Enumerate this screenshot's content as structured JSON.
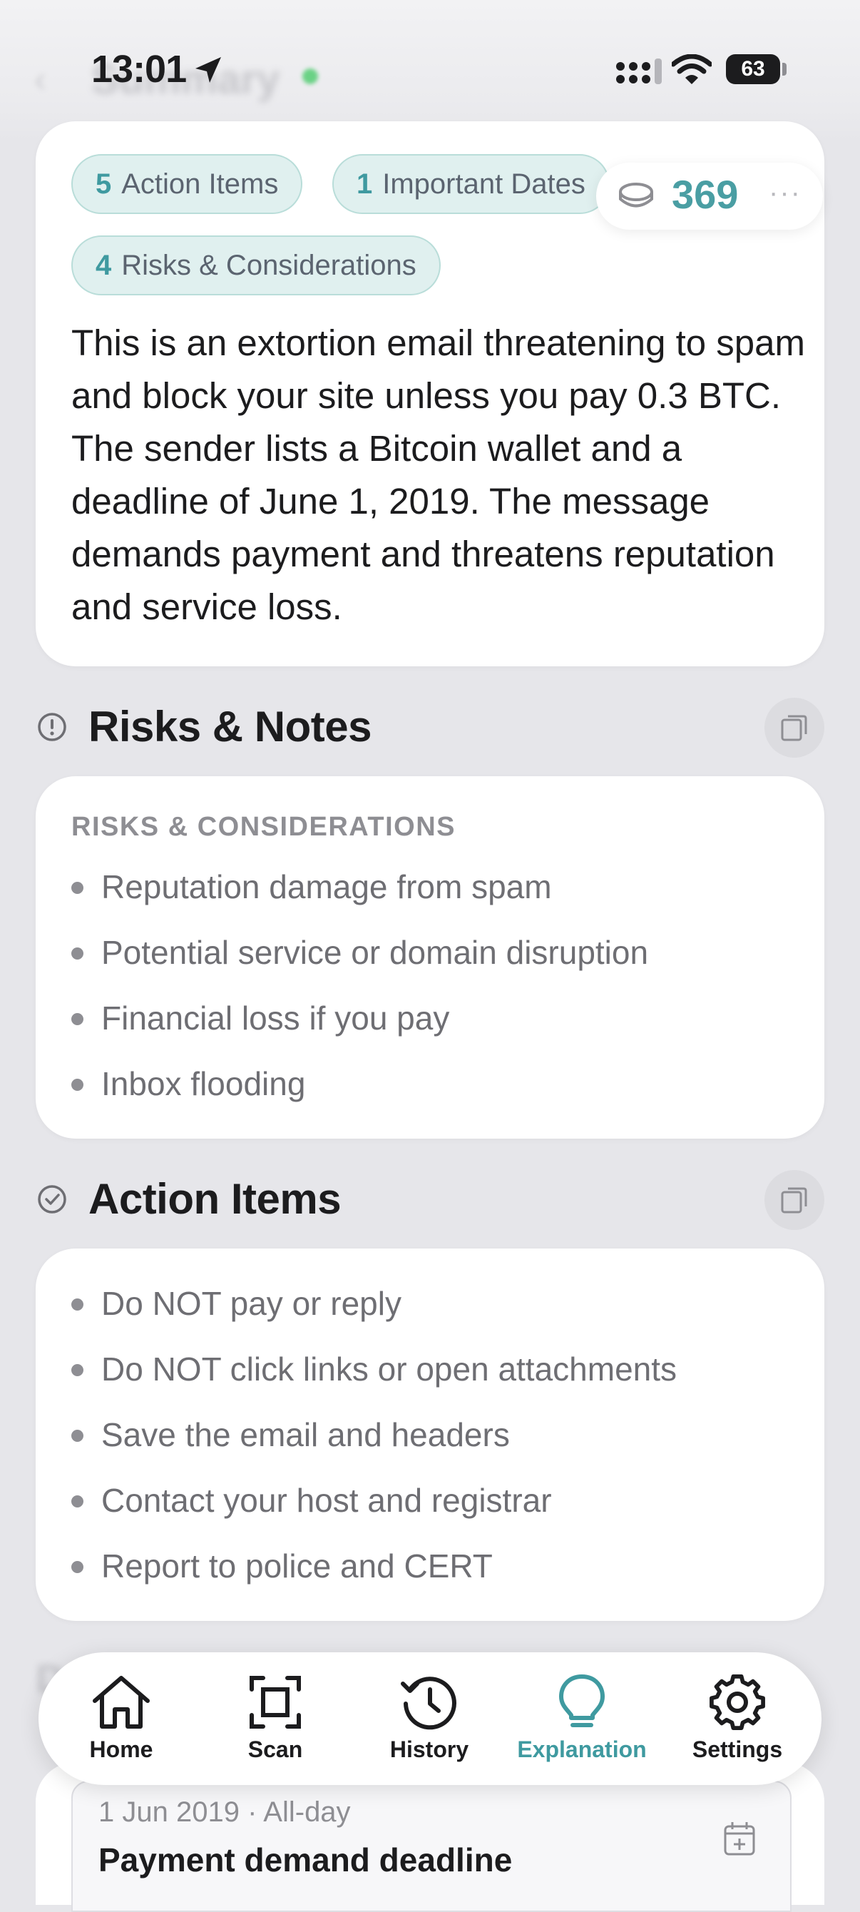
{
  "status_bar": {
    "time": "13:01",
    "battery": "63"
  },
  "header": {
    "title": "Summary"
  },
  "summary": {
    "chips": [
      {
        "count": "5",
        "label": "Action Items"
      },
      {
        "count": "1",
        "label": "Important Dates"
      },
      {
        "count": "4",
        "label": "Risks & Considerations"
      }
    ],
    "text": "This is an extortion email threatening to spam and block your site unless you pay 0.3 BTC. The sender lists a Bitcoin wallet and a deadline of June 1, 2019. The message demands payment and threatens reputation and service loss.",
    "coins": "369",
    "more_label": "···"
  },
  "risks_section": {
    "title": "Risks & Notes",
    "subheading": "RISKS & CONSIDERATIONS",
    "items": [
      "Reputation damage from spam",
      "Potential service or domain disruption",
      "Financial loss if you pay",
      "Inbox flooding"
    ]
  },
  "actions_section": {
    "title": "Action Items",
    "items": [
      "Do NOT pay or reply",
      "Do NOT click links or open attachments",
      "Save the email and headers",
      "Contact your host and registrar",
      "Report to police and CERT"
    ]
  },
  "dates_section": {
    "title": "Dates",
    "events": [
      {
        "meta": "1 Jun 2019 · All-day",
        "title": "Payment demand deadline"
      }
    ]
  },
  "tabs": [
    {
      "label": "Home",
      "icon": "house-icon"
    },
    {
      "label": "Scan",
      "icon": "scan-icon"
    },
    {
      "label": "History",
      "icon": "history-icon"
    },
    {
      "label": "Explanation",
      "icon": "lightbulb-icon",
      "active": true
    },
    {
      "label": "Settings",
      "icon": "gear-icon"
    }
  ],
  "colors": {
    "accent": "#3f9aa0",
    "chip_bg": "#e0f0ef",
    "text": "#1c1c1e",
    "muted": "#6e6e73"
  }
}
